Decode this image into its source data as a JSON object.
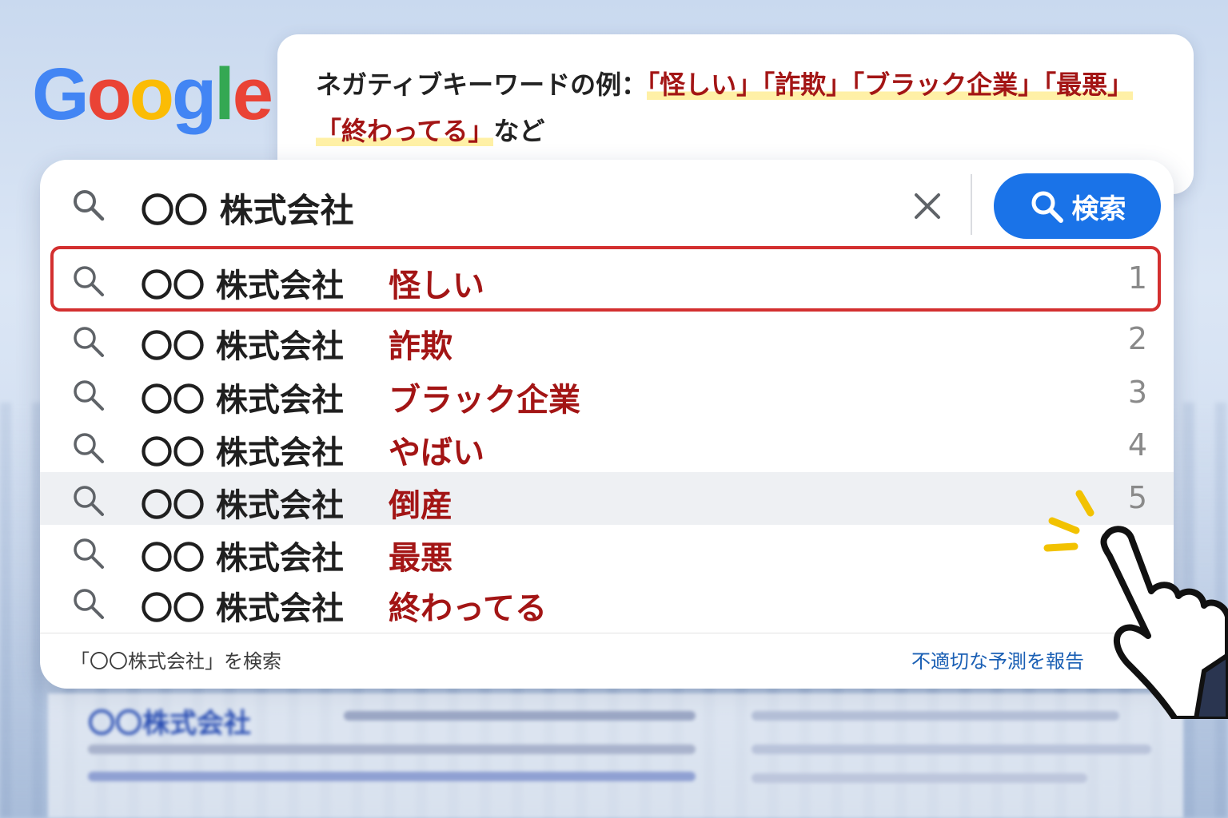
{
  "logo": {
    "letters": [
      {
        "char": "G",
        "color": "#4285F4"
      },
      {
        "char": "o",
        "color": "#EA4335"
      },
      {
        "char": "o",
        "color": "#FBBC05"
      },
      {
        "char": "g",
        "color": "#4285F4"
      },
      {
        "char": "l",
        "color": "#34A853"
      },
      {
        "char": "e",
        "color": "#EA4335"
      }
    ]
  },
  "note": {
    "line1_prefix": "ネガティブキーワードの例：",
    "line1_highlight": "「怪しい」「詐欺」「ブラック企業」「最悪」",
    "line2_highlight": "「終わってる」",
    "line2_suffix": "など"
  },
  "search": {
    "query": "〇〇 株式会社",
    "clear_icon": "close-icon",
    "button_label": "検索",
    "button_icon": "search-icon"
  },
  "suggestions": [
    {
      "base": "〇〇 株式会社",
      "keyword": "怪しい",
      "rank": "1"
    },
    {
      "base": "〇〇 株式会社",
      "keyword": "詐欺",
      "rank": "2"
    },
    {
      "base": "〇〇 株式会社",
      "keyword": "ブラック企業",
      "rank": "3"
    },
    {
      "base": "〇〇 株式会社",
      "keyword": "やばい",
      "rank": "4"
    },
    {
      "base": "〇〇 株式会社",
      "keyword": "倒産",
      "rank": "5"
    },
    {
      "base": "〇〇 株式会社",
      "keyword": "最悪",
      "rank": ""
    },
    {
      "base": "〇〇 株式会社",
      "keyword": "終わってる",
      "rank": ""
    }
  ],
  "footer": {
    "search_for": "「〇〇株式会社」を検索",
    "report": "不適切な予測を報告"
  },
  "background_results": {
    "title": "〇〇株式会社"
  },
  "colors": {
    "accent_blue": "#1a73e8",
    "negative_red": "#a31515",
    "highlight_border": "#d32f2f",
    "highlight_marker": "#ffee96"
  }
}
